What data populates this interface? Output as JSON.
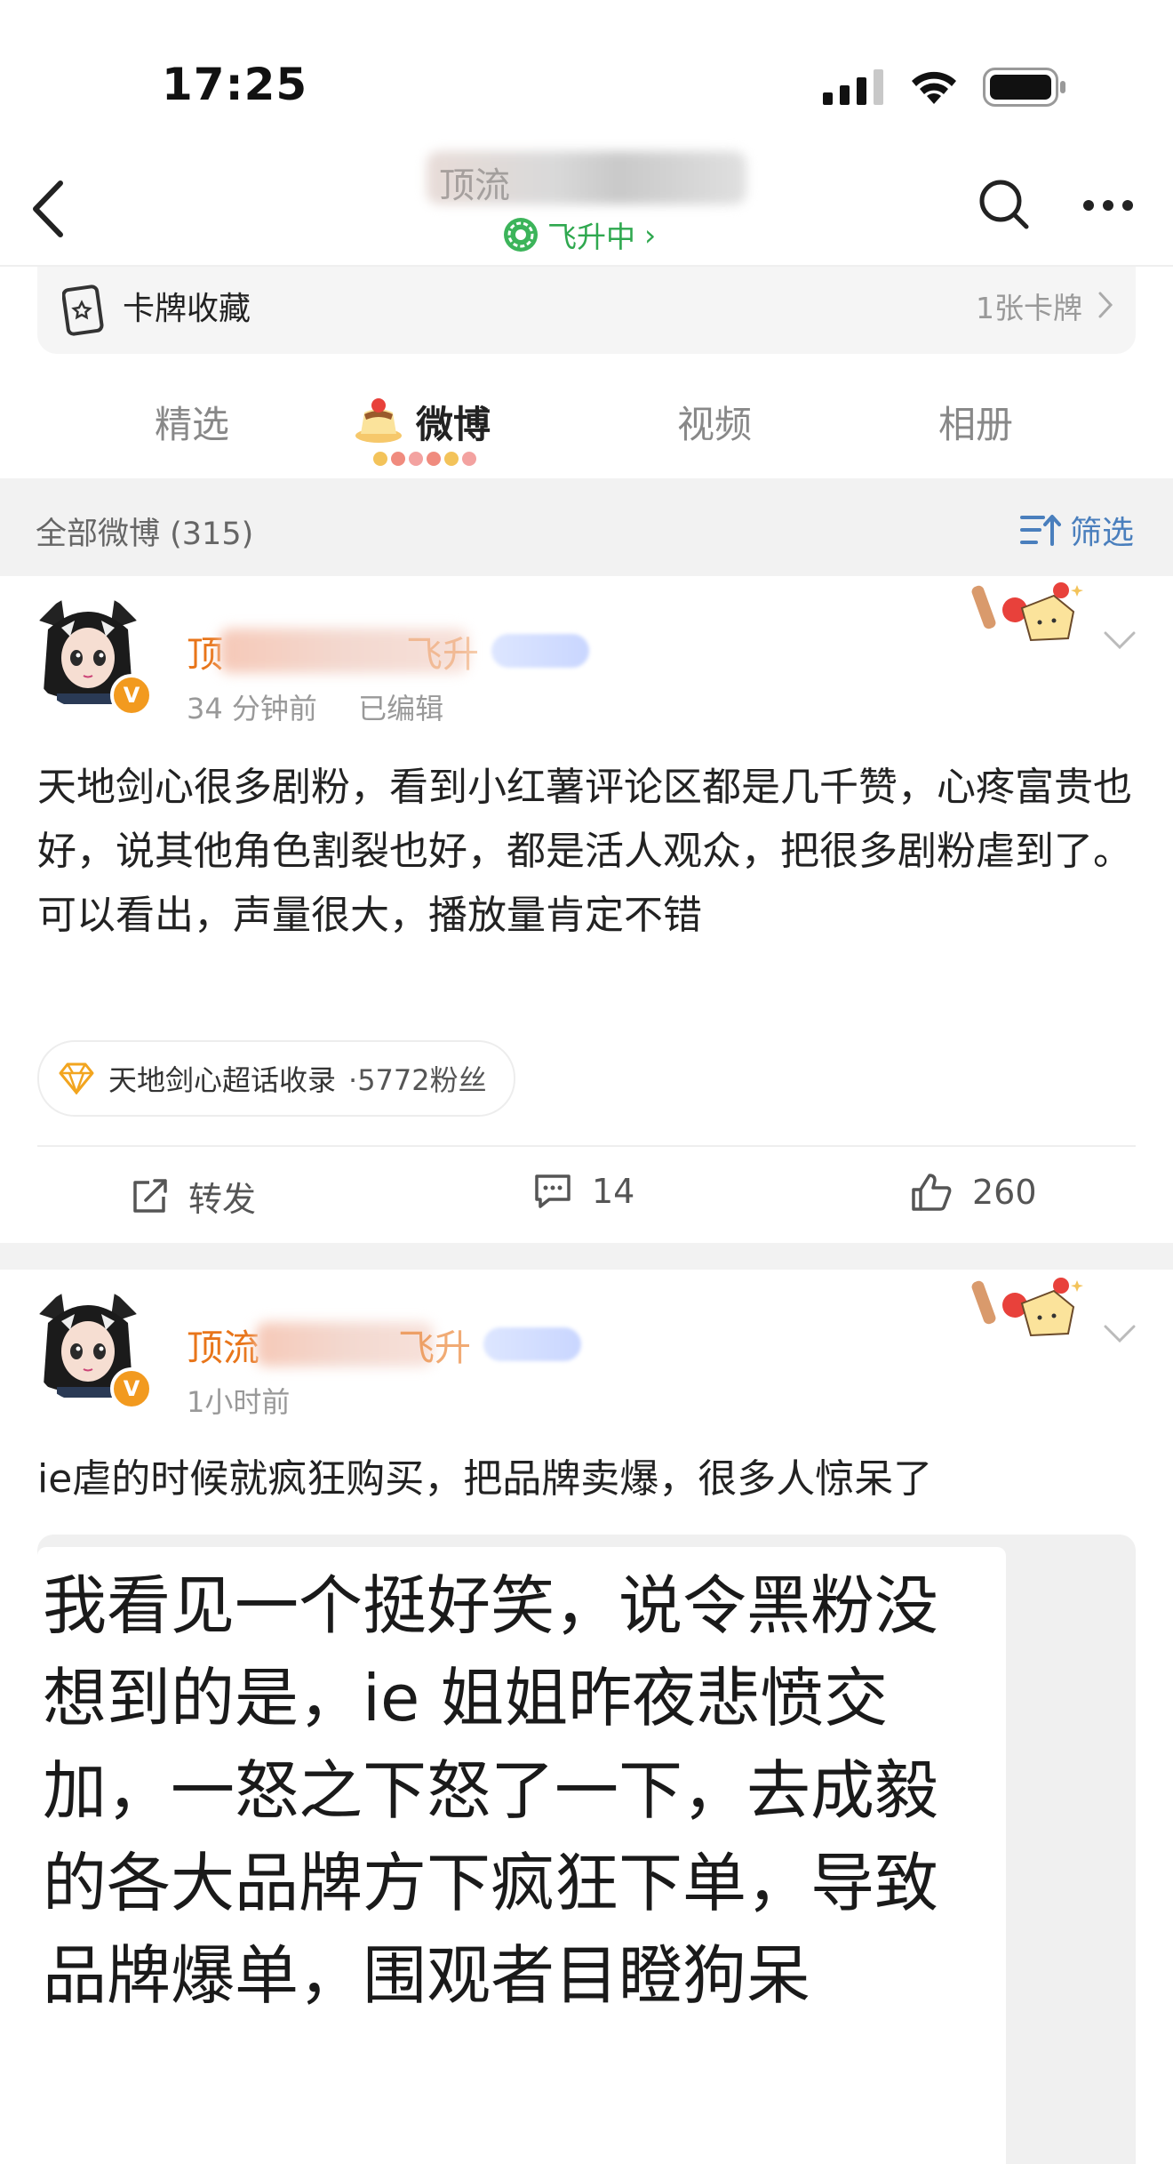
{
  "status_bar": {
    "time": "17:25"
  },
  "nav": {
    "title": "顶流",
    "subtitle": "飞升中",
    "subtitle_arrow": "›",
    "back_icon": "chevron-left-icon",
    "search_icon": "search-icon",
    "more_icon": "more-icon"
  },
  "card_collection": {
    "label": "卡牌收藏",
    "count": "1张卡牌"
  },
  "tabs": [
    {
      "label": "精选",
      "active": false
    },
    {
      "label": "微博",
      "active": true
    },
    {
      "label": "视频",
      "active": false
    },
    {
      "label": "相册",
      "active": false
    }
  ],
  "filter_bar": {
    "all_label": "全部微博 (315)",
    "filter_label": "筛选"
  },
  "posts": [
    {
      "username": "顶",
      "username_tail": "飞升",
      "time": "34 分钟前",
      "edited": "已编辑",
      "text": "天地剑心很多剧粉，看到小红薯评论区都是几千赞，心疼富贵也好，说其他角色割裂也好，都是活人观众，把很多剧粉虐到了。可以看出，声量很大，播放量肯定不错",
      "topic": {
        "name": "天地剑心超话收录",
        "fans": "·5772粉丝"
      },
      "actions": {
        "repost": "转发",
        "comments": "14",
        "likes": "260"
      }
    },
    {
      "username": "顶流",
      "username_tail": "飞升",
      "time": "1小时前",
      "text": "ie虐的时候就疯狂购买，把品牌卖爆，很多人惊呆了",
      "image_text": "我看见一个挺好笑，说令黑粉没想到的是，ie 姐姐昨夜悲愤交加，一怒之下怒了一下，去成毅的各大品牌方下疯狂下单，导致品牌爆单，围观者目瞪狗呆"
    }
  ],
  "colors": {
    "accent_orange": "#e8751a",
    "green": "#2fa84f",
    "link_blue": "#4a7fbd",
    "vip_orange": "#f29a1f"
  }
}
